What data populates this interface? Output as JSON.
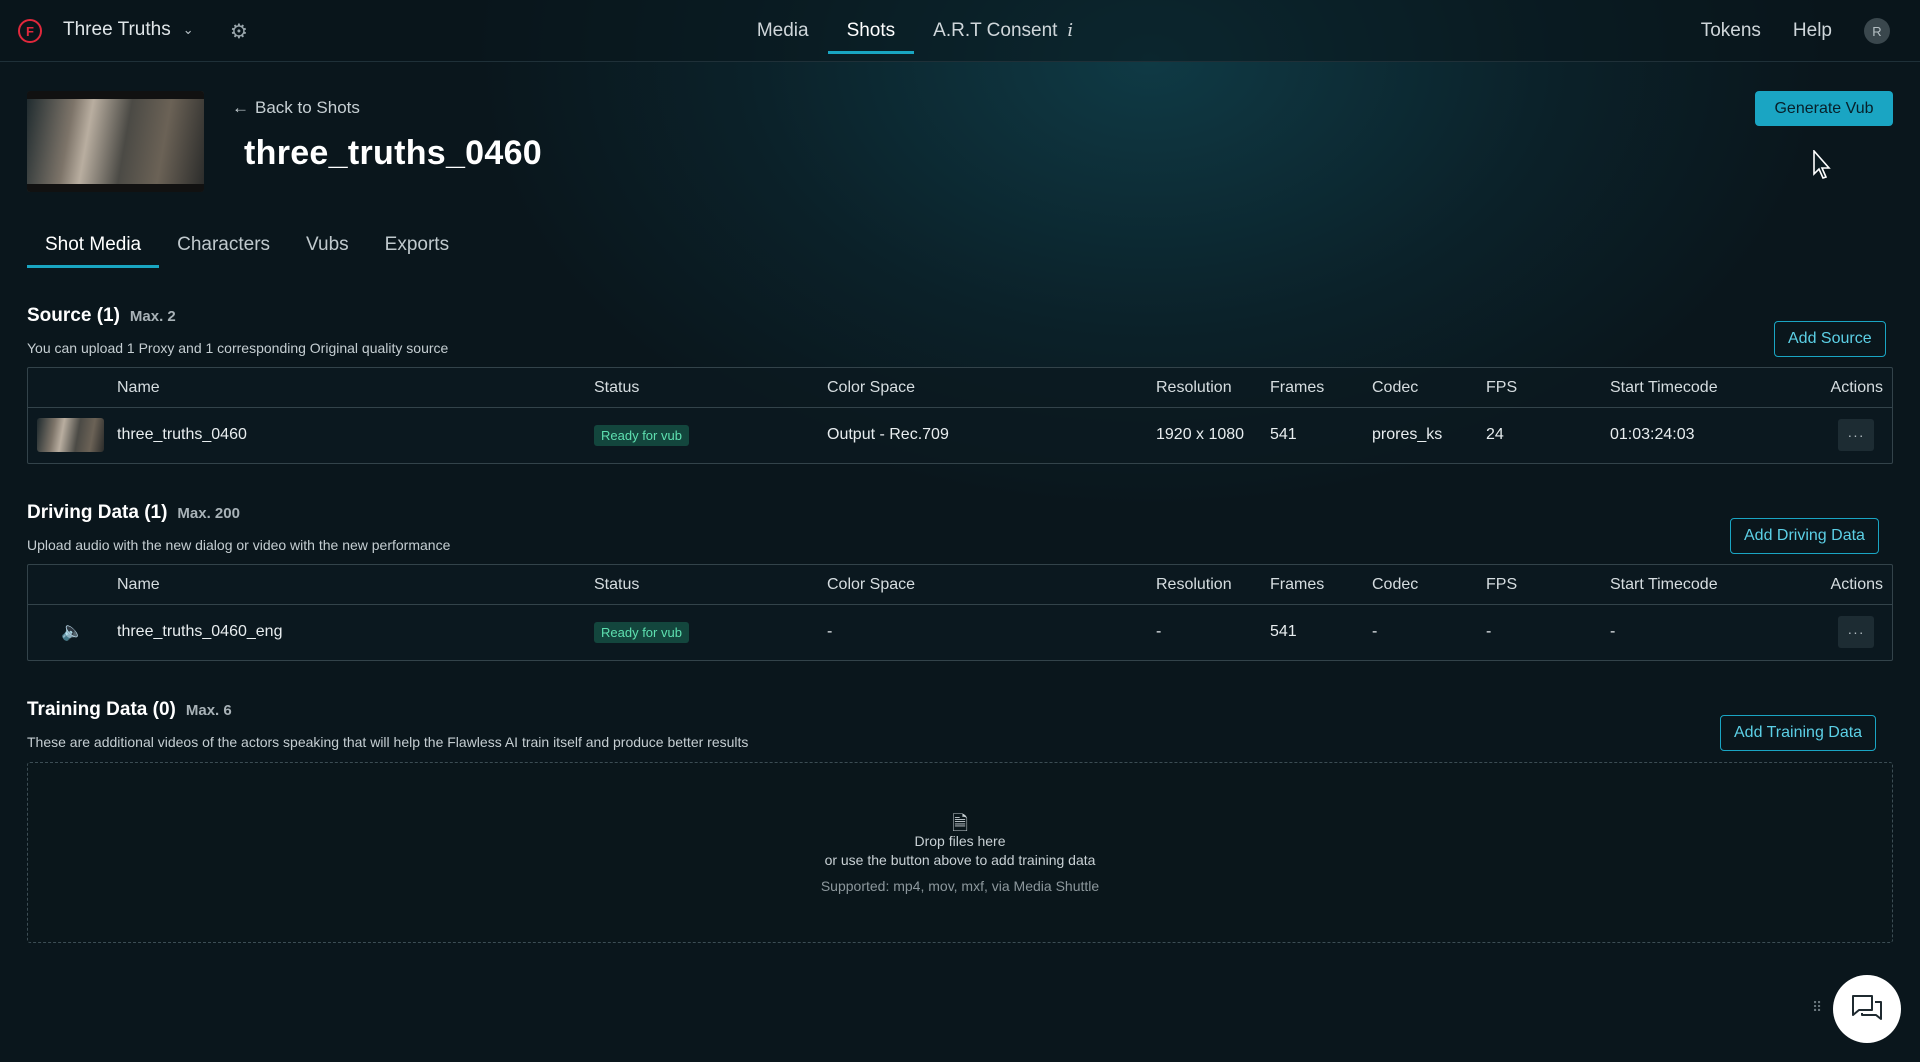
{
  "topbar": {
    "logo_letter": "F",
    "project_name": "Three Truths",
    "project_chevron": "⌄",
    "settings_icon": "⚙",
    "nav": [
      {
        "label": "Media"
      },
      {
        "label": "Shots"
      },
      {
        "label": "A.R.T Consent",
        "info": "i"
      }
    ],
    "tokens_label": "Tokens",
    "help_label": "Help",
    "avatar_initial": "R"
  },
  "header": {
    "back_label": "Back to Shots",
    "title": "three_truths_0460",
    "generate_label": "Generate Vub"
  },
  "tabs": [
    "Shot Media",
    "Characters",
    "Vubs",
    "Exports"
  ],
  "columns": {
    "name": "Name",
    "status": "Status",
    "color_space": "Color Space",
    "resolution": "Resolution",
    "frames": "Frames",
    "codec": "Codec",
    "fps": "FPS",
    "start_timecode": "Start Timecode",
    "actions": "Actions"
  },
  "source": {
    "title": "Source (1)",
    "max": "Max. 2",
    "description": "You can upload 1 Proxy and 1 corresponding Original quality source",
    "add_label": "Add Source",
    "row": {
      "name": "three_truths_0460",
      "status": "Ready for vub",
      "color_space": "Output - Rec.709",
      "resolution": "1920 x 1080",
      "frames": "541",
      "codec": "prores_ks",
      "fps": "24",
      "start_timecode": "01:03:24:03",
      "actions": "···"
    }
  },
  "driving": {
    "title": "Driving Data (1)",
    "max": "Max. 200",
    "description": "Upload audio with the new dialog or video with the new performance",
    "add_label": "Add Driving Data",
    "row": {
      "icon": "🔈",
      "name": "three_truths_0460_eng",
      "status": "Ready for vub",
      "color_space": "-",
      "resolution": "-",
      "frames": "541",
      "codec": "-",
      "fps": "-",
      "start_timecode": "-",
      "actions": "···"
    }
  },
  "training": {
    "title": "Training Data (0)",
    "max": "Max. 6",
    "description": "These are additional videos of the actors speaking that will help the Flawless AI train itself and produce better results",
    "add_label": "Add Training Data",
    "drop_icon": "🗎",
    "drop_line1": "Drop files here",
    "drop_line2": "or use the button above to add training data",
    "drop_line3": "Supported: mp4, mov, mxf, via Media Shuttle"
  },
  "widgets": {
    "drag_dots": "⠿",
    "accent_color": "#1aa5c3"
  }
}
